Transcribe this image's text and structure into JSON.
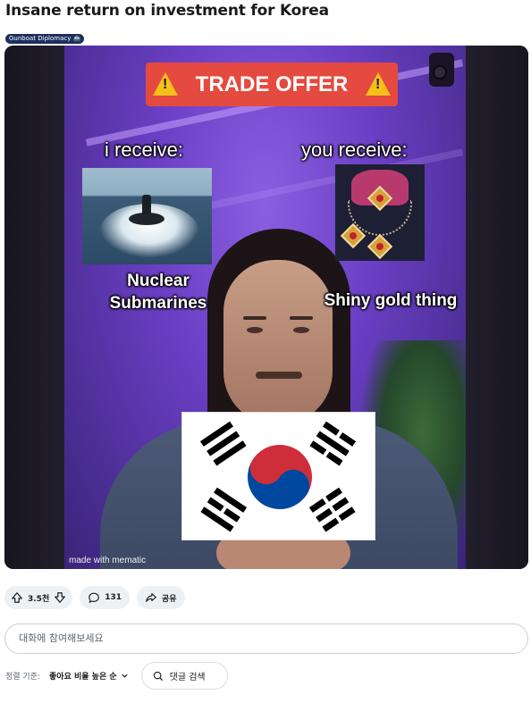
{
  "post": {
    "title": "Insane return on investment for Korea",
    "flair": "Gunboat Diplomacy 🚢"
  },
  "meme": {
    "banner": "TRADE OFFER",
    "i_receive": "i receive:",
    "you_receive": "you receive:",
    "left_item": "Nuclear Submarines",
    "right_item": "Shiny gold thing",
    "watermark": "made with mematic"
  },
  "actions": {
    "vote_count": "3.5천",
    "comment_count": "131",
    "share_label": "공유"
  },
  "comment_input": {
    "placeholder": "대화에 참여해보세요"
  },
  "sort": {
    "label": "정렬 기준:",
    "value": "좋아요 비율 높은 순"
  },
  "search": {
    "label": "댓글 검색"
  },
  "colors": {
    "banner_red": "#e44a3f",
    "flair_bg": "#1c2f5c",
    "pill_bg": "#eef1f3",
    "flag_red": "#cd2e3a",
    "flag_blue": "#0047a0"
  },
  "icons": [
    "upvote-icon",
    "downvote-icon",
    "comment-icon",
    "share-icon",
    "search-icon",
    "chevron-down-icon",
    "warning-icon"
  ]
}
